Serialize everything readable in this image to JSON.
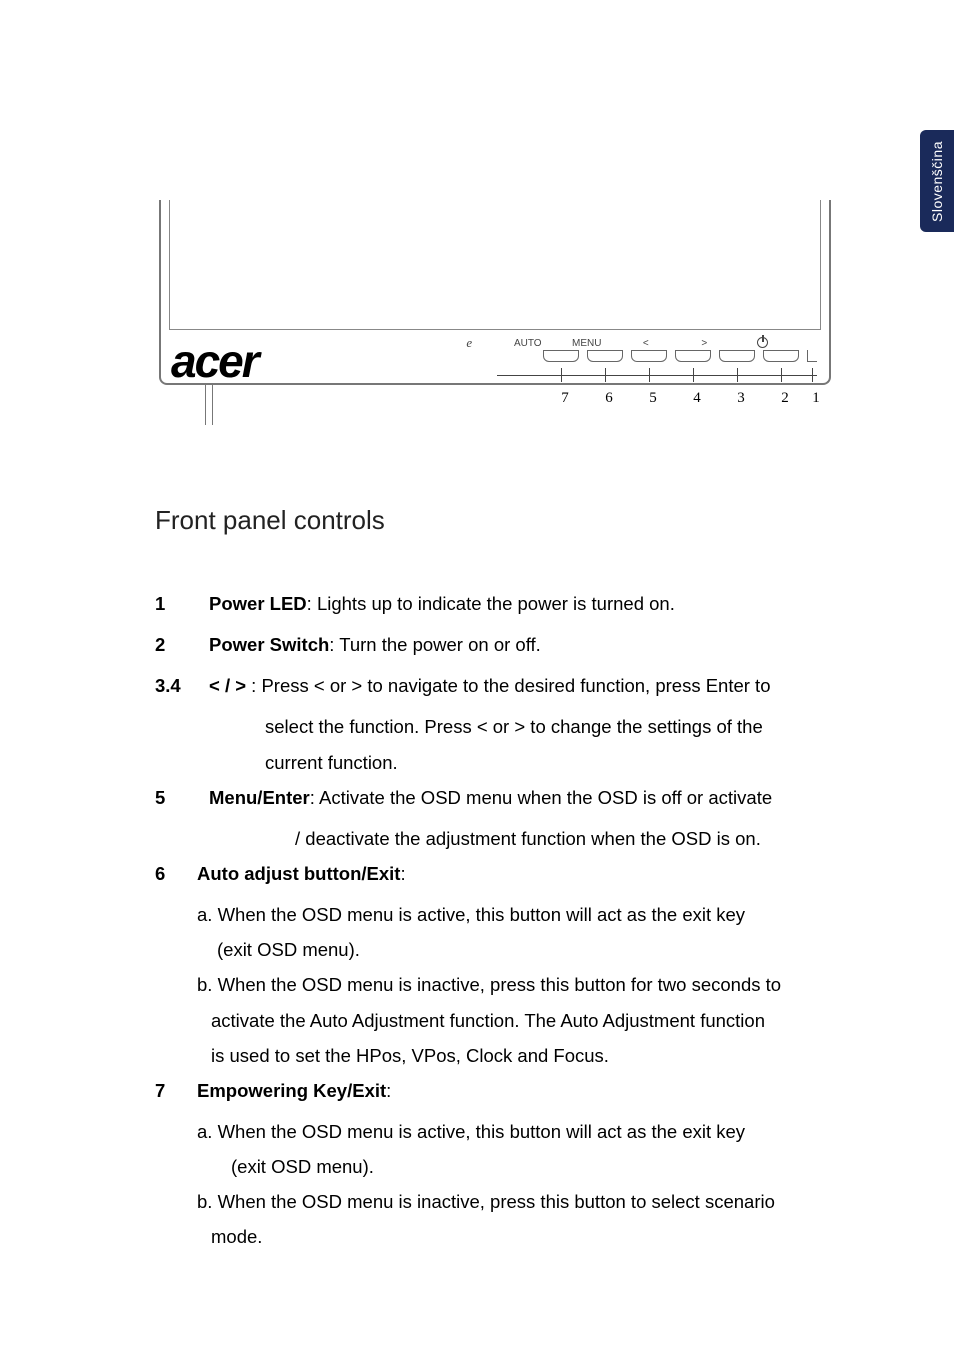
{
  "sideTab": "Slovenščina",
  "brand": "acer",
  "panel": {
    "labels": {
      "e": "e",
      "auto": "AUTO",
      "menu": "MENU",
      "lt": "<",
      "gt": ">"
    },
    "numbers": [
      "7",
      "6",
      "5",
      "4",
      "3",
      "2",
      "1"
    ]
  },
  "heading": "Front panel controls",
  "items": {
    "n1": {
      "num": "1",
      "label": "Power LED",
      "text": ": Lights up to indicate the power is turned on."
    },
    "n2": {
      "num": "2",
      "label": "Power Switch",
      "text": ": Turn the power on or off."
    },
    "n34": {
      "num": "3.4",
      "label": "< / >",
      "text": " : Press < or > to navigate to the desired function, press Enter to",
      "cont1": "select the function. Press < or > to change the settings of the",
      "cont2": "current function."
    },
    "n5": {
      "num": "5",
      "label": "Menu/Enter",
      "text": ": Activate the OSD menu when the OSD is off or activate",
      "cont1": "/ deactivate the adjustment function when the OSD is on."
    },
    "n6": {
      "num": "6",
      "label": "Auto adjust button/Exit",
      "colon": ":",
      "a1": "a. When the OSD menu is active, this button will act as the exit key",
      "a2": "(exit OSD menu).",
      "b1": "b. When the OSD menu is inactive, press this button for two seconds to",
      "b2": "activate the Auto Adjustment function. The Auto Adjustment function",
      "b3": "is used to set the HPos, VPos, Clock and Focus."
    },
    "n7": {
      "num": "7",
      "label": "Empowering Key/Exit",
      "colon": ":",
      "a1": "a. When the OSD menu is active, this button will act as the exit key",
      "a2": "(exit OSD menu).",
      "b1": "b. When the OSD menu is inactive, press this button to select scenario",
      "b2": "mode."
    }
  }
}
